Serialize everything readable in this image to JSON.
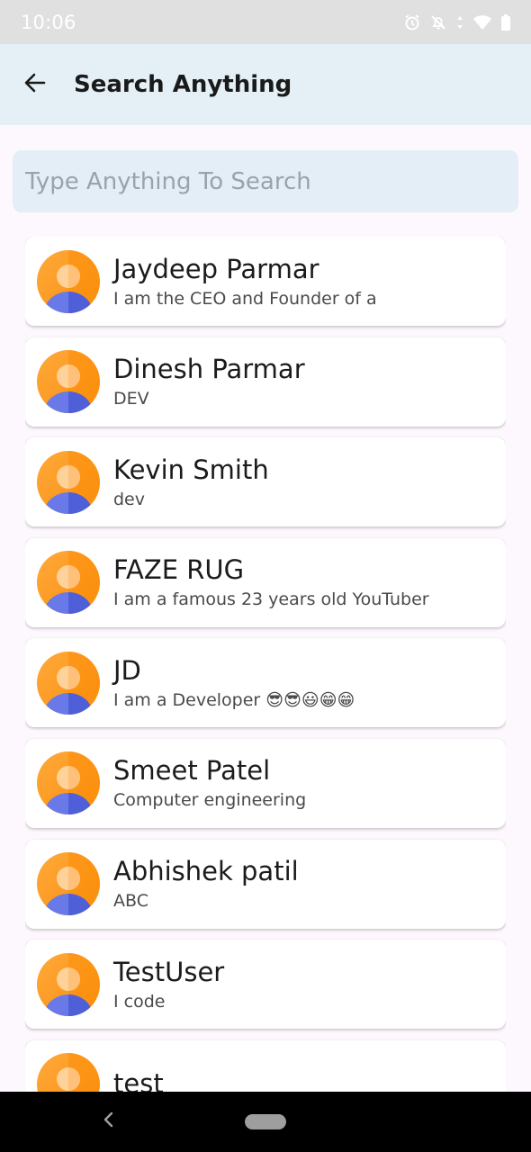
{
  "status_bar": {
    "time": "10:06",
    "icons": [
      "alarm-icon",
      "notifications-off-icon",
      "data-arrows-icon",
      "wifi-icon",
      "battery-icon"
    ]
  },
  "app_bar": {
    "back_icon": "arrow-left-icon",
    "title": "Search Anything"
  },
  "search": {
    "placeholder": "Type Anything To Search",
    "value": ""
  },
  "users": [
    {
      "name": "Jaydeep Parmar",
      "bio": "I am the CEO and Founder of a"
    },
    {
      "name": "Dinesh Parmar",
      "bio": "DEV"
    },
    {
      "name": "Kevin Smith",
      "bio": "dev"
    },
    {
      "name": "FAZE RUG",
      "bio": "I am a famous 23 years old YouTuber"
    },
    {
      "name": "JD",
      "bio": "I am a Developer 😎😎😃😁😁"
    },
    {
      "name": "Smeet Patel",
      "bio": "Computer engineering"
    },
    {
      "name": "Abhishek patil",
      "bio": "ABC"
    },
    {
      "name": "TestUser",
      "bio": "I code"
    },
    {
      "name": "test",
      "bio": ""
    }
  ],
  "colors": {
    "app_bar_bg": "#e4eff6",
    "avatar_orange": "#ff9a1f",
    "avatar_body": "#5b6ee0"
  },
  "nav_bar": {
    "icons": [
      "nav-back-icon",
      "home-pill-icon"
    ]
  }
}
